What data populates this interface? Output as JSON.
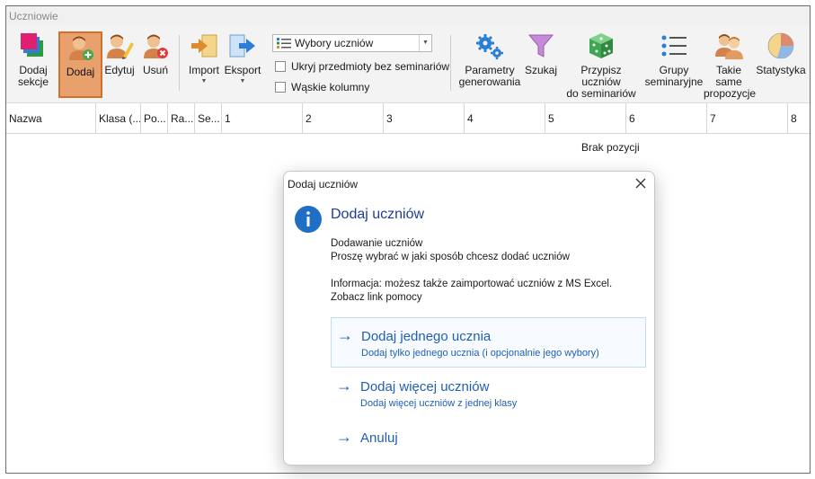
{
  "window": {
    "title": "Uczniowie"
  },
  "toolbar": {
    "add_sections": {
      "label": "Dodaj\nsekcje",
      "icon": "sections-icon"
    },
    "add": {
      "label": "Dodaj",
      "icon": "add-user-icon"
    },
    "edit": {
      "label": "Edytuj",
      "icon": "edit-user-icon"
    },
    "delete": {
      "label": "Usuń",
      "icon": "delete-user-icon"
    },
    "import": {
      "label": "Import",
      "icon": "import-icon"
    },
    "export": {
      "label": "Eksport",
      "icon": "export-icon"
    },
    "choices_combo": {
      "value": "Wybory uczniów"
    },
    "hide_subjects": {
      "label": "Ukryj przedmioty bez seminariów",
      "checked": false
    },
    "narrow_columns": {
      "label": "Wąskie kolumny",
      "checked": false
    },
    "generation_params": {
      "label": "Parametry\ngenerowania",
      "icon": "gears-icon"
    },
    "search": {
      "label": "Szukaj",
      "icon": "filter-icon"
    },
    "assign": {
      "label": "Przypisz uczniów\ndo seminariów",
      "icon": "dice-icon"
    },
    "groups": {
      "label": "Grupy\nseminaryjne",
      "icon": "list-icon"
    },
    "same_proposals": {
      "label": "Takie same\npropozycje",
      "icon": "two-users-icon"
    },
    "stats": {
      "label": "Statystyka",
      "icon": "pie-chart-icon"
    }
  },
  "grid": {
    "columns": [
      "Nazwa",
      "Klasa (...",
      "Po...",
      "Ra...",
      "Se...",
      "1",
      "2",
      "3",
      "4",
      "5",
      "6",
      "7",
      "8"
    ],
    "empty_text": "Brak pozycji"
  },
  "dialog": {
    "title": "Dodaj uczniów",
    "heading": "Dodaj uczniów",
    "line1": "Dodawanie uczniów",
    "line2": "Proszę wybrać w jaki sposób chcesz dodać uczniów",
    "info1": "Informacja: możesz także zaimportować uczniów z MS Excel.",
    "info2": "Zobacz link pomocy",
    "commands": [
      {
        "title": "Dodaj jednego ucznia",
        "subtitle": "Dodaj tylko jednego ucznia (i opcjonalnie jego wybory)"
      },
      {
        "title": "Dodaj więcej uczniów",
        "subtitle": "Dodaj więcej uczniów z jednej klasy"
      },
      {
        "title": "Anuluj",
        "subtitle": ""
      }
    ]
  },
  "colors": {
    "accent": "#1f5fb6",
    "active_button": "#e8a06c",
    "heading": "#1f3d96"
  }
}
